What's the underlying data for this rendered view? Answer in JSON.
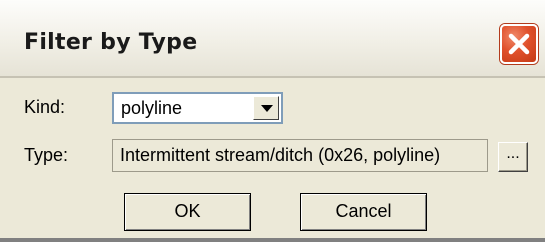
{
  "window": {
    "title": "Filter by Type",
    "close_icon": "close-icon"
  },
  "form": {
    "kind_label": "Kind:",
    "kind_value": "polyline",
    "type_label": "Type:",
    "type_value": "Intermittent stream/ditch (0x26, polyline)",
    "browse_label": "..."
  },
  "buttons": {
    "ok_label": "OK",
    "cancel_label": "Cancel"
  },
  "colors": {
    "dialog_bg": "#ece9d8",
    "close_red": "#e0512c",
    "field_border": "#7f9db9"
  }
}
